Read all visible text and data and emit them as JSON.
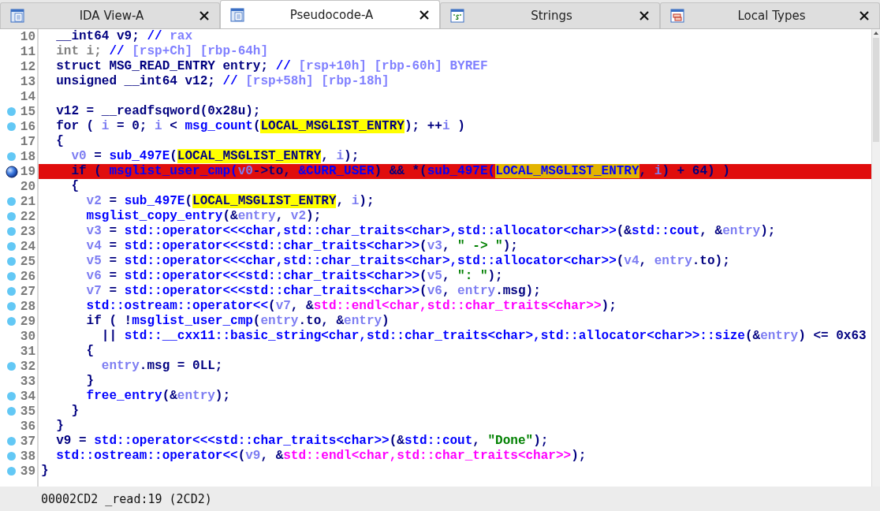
{
  "tabs": [
    {
      "label": "IDA View-A",
      "kind": "view",
      "selected": false
    },
    {
      "label": "Pseudocode-A",
      "kind": "view",
      "selected": true
    },
    {
      "label": "Strings",
      "kind": "strings",
      "selected": false
    },
    {
      "label": "Local Types",
      "kind": "types",
      "selected": false
    }
  ],
  "lines": [
    {
      "number": "10",
      "dot": false,
      "breakpoint": false,
      "tokens": [
        {
          "kind": "kw",
          "text": "  __int64 v9; "
        },
        {
          "kind": "cmt",
          "text": "// "
        },
        {
          "kind": "cmtx",
          "text": "rax"
        }
      ]
    },
    {
      "number": "11",
      "dot": false,
      "breakpoint": false,
      "tokens": [
        {
          "kind": "dim",
          "text": "  int i; "
        },
        {
          "kind": "cmt",
          "text": "// "
        },
        {
          "kind": "cmtx",
          "text": "[rsp+Ch] [rbp-64h]"
        }
      ]
    },
    {
      "number": "12",
      "dot": false,
      "breakpoint": false,
      "tokens": [
        {
          "kind": "kw",
          "text": "  struct MSG_READ_ENTRY entry; "
        },
        {
          "kind": "cmt",
          "text": "// "
        },
        {
          "kind": "cmtx",
          "text": "[rsp+10h] [rbp-60h] BYREF"
        }
      ]
    },
    {
      "number": "13",
      "dot": false,
      "breakpoint": false,
      "tokens": [
        {
          "kind": "kw",
          "text": "  unsigned __int64 v12; "
        },
        {
          "kind": "cmt",
          "text": "// "
        },
        {
          "kind": "cmtx",
          "text": "[rsp+58h] [rbp-18h]"
        }
      ]
    },
    {
      "number": "14",
      "dot": false,
      "breakpoint": false
    },
    {
      "number": "15",
      "dot": true,
      "breakpoint": false,
      "tokens": [
        {
          "kind": "kw",
          "text": "  v12 = __readfsqword(0x28u);"
        }
      ]
    },
    {
      "number": "16",
      "dot": true,
      "breakpoint": false,
      "tokens": [
        {
          "kind": "kw",
          "text": "  for ( "
        },
        {
          "kind": "var",
          "text": "i"
        },
        {
          "kind": "kw",
          "text": " = 0; "
        },
        {
          "kind": "var",
          "text": "i"
        },
        {
          "kind": "kw",
          "text": " < "
        },
        {
          "kind": "fn",
          "text": "msg_count"
        },
        {
          "kind": "kw",
          "text": "("
        },
        {
          "kind": "hl",
          "text": "LOCAL_MSGLIST_ENTRY"
        },
        {
          "kind": "kw",
          "text": "); ++"
        },
        {
          "kind": "var",
          "text": "i"
        },
        {
          "kind": "kw",
          "text": " )"
        }
      ]
    },
    {
      "number": "17",
      "dot": false,
      "breakpoint": false,
      "tokens": [
        {
          "kind": "kw",
          "text": "  {"
        }
      ]
    },
    {
      "number": "18",
      "dot": true,
      "breakpoint": false,
      "tokens": [
        {
          "kind": "var",
          "text": "    v0"
        },
        {
          "kind": "kw",
          "text": " = "
        },
        {
          "kind": "fn",
          "text": "sub_497E"
        },
        {
          "kind": "kw",
          "text": "("
        },
        {
          "kind": "hl",
          "text": "LOCAL_MSGLIST_ENTRY"
        },
        {
          "kind": "kw",
          "text": ", "
        },
        {
          "kind": "var",
          "text": "i"
        },
        {
          "kind": "kw",
          "text": ");"
        }
      ]
    },
    {
      "number": "19",
      "dot": true,
      "breakpoint": true,
      "tokens": [
        {
          "kind": "kw",
          "text": "    if ( "
        },
        {
          "kind": "fn",
          "text": "msglist_user_cmp"
        },
        {
          "kind": "fn",
          "text": "("
        },
        {
          "kind": "var",
          "text": "v0"
        },
        {
          "kind": "kw",
          "text": "->to, "
        },
        {
          "kind": "fn",
          "text": "&CURR_USER"
        },
        {
          "kind": "kw",
          "text": ") && *("
        },
        {
          "kind": "fn",
          "text": "sub_497E"
        },
        {
          "kind": "fn",
          "text": "("
        },
        {
          "kind": "hl",
          "text": "LOCAL_MSGLIST_ENTRY"
        },
        {
          "kind": "kw",
          "text": ", "
        },
        {
          "kind": "var",
          "text": "i"
        },
        {
          "kind": "kw",
          "text": ") + 64) )"
        }
      ]
    },
    {
      "number": "20",
      "dot": false,
      "breakpoint": false,
      "tokens": [
        {
          "kind": "kw",
          "text": "    {"
        }
      ]
    },
    {
      "number": "21",
      "dot": true,
      "breakpoint": false,
      "tokens": [
        {
          "kind": "var",
          "text": "      v2"
        },
        {
          "kind": "kw",
          "text": " = "
        },
        {
          "kind": "fn",
          "text": "sub_497E"
        },
        {
          "kind": "kw",
          "text": "("
        },
        {
          "kind": "hl",
          "text": "LOCAL_MSGLIST_ENTRY"
        },
        {
          "kind": "kw",
          "text": ", "
        },
        {
          "kind": "var",
          "text": "i"
        },
        {
          "kind": "kw",
          "text": ");"
        }
      ]
    },
    {
      "number": "22",
      "dot": true,
      "breakpoint": false,
      "tokens": [
        {
          "kind": "fn",
          "text": "      msglist_copy_entry"
        },
        {
          "kind": "kw",
          "text": "(&"
        },
        {
          "kind": "var",
          "text": "entry"
        },
        {
          "kind": "kw",
          "text": ", "
        },
        {
          "kind": "var",
          "text": "v2"
        },
        {
          "kind": "kw",
          "text": ");"
        }
      ]
    },
    {
      "number": "23",
      "dot": true,
      "breakpoint": false,
      "tokens": [
        {
          "kind": "var",
          "text": "      v3"
        },
        {
          "kind": "kw",
          "text": " = "
        },
        {
          "kind": "fn",
          "text": "std::operator<<<char,std::char_traits<char>,std::allocator<char>>"
        },
        {
          "kind": "kw",
          "text": "(&"
        },
        {
          "kind": "fn",
          "text": "std::cout"
        },
        {
          "kind": "kw",
          "text": ", &"
        },
        {
          "kind": "var",
          "text": "entry"
        },
        {
          "kind": "kw",
          "text": ");"
        }
      ]
    },
    {
      "number": "24",
      "dot": true,
      "breakpoint": false,
      "tokens": [
        {
          "kind": "var",
          "text": "      v4"
        },
        {
          "kind": "kw",
          "text": " = "
        },
        {
          "kind": "fn",
          "text": "std::operator<<<std::char_traits<char>>"
        },
        {
          "kind": "kw",
          "text": "("
        },
        {
          "kind": "var",
          "text": "v3"
        },
        {
          "kind": "kw",
          "text": ", "
        },
        {
          "kind": "str",
          "text": "\" -> \""
        },
        {
          "kind": "kw",
          "text": ");"
        }
      ]
    },
    {
      "number": "25",
      "dot": true,
      "breakpoint": false,
      "tokens": [
        {
          "kind": "var",
          "text": "      v5"
        },
        {
          "kind": "kw",
          "text": " = "
        },
        {
          "kind": "fn",
          "text": "std::operator<<<char,std::char_traits<char>,std::allocator<char>>"
        },
        {
          "kind": "kw",
          "text": "("
        },
        {
          "kind": "var",
          "text": "v4"
        },
        {
          "kind": "kw",
          "text": ", "
        },
        {
          "kind": "var",
          "text": "entry"
        },
        {
          "kind": "kw",
          "text": ".to);"
        }
      ]
    },
    {
      "number": "26",
      "dot": true,
      "breakpoint": false,
      "tokens": [
        {
          "kind": "var",
          "text": "      v6"
        },
        {
          "kind": "kw",
          "text": " = "
        },
        {
          "kind": "fn",
          "text": "std::operator<<<std::char_traits<char>>"
        },
        {
          "kind": "kw",
          "text": "("
        },
        {
          "kind": "var",
          "text": "v5"
        },
        {
          "kind": "kw",
          "text": ", "
        },
        {
          "kind": "str",
          "text": "\": \""
        },
        {
          "kind": "kw",
          "text": ");"
        }
      ]
    },
    {
      "number": "27",
      "dot": true,
      "breakpoint": false,
      "tokens": [
        {
          "kind": "var",
          "text": "      v7"
        },
        {
          "kind": "kw",
          "text": " = "
        },
        {
          "kind": "fn",
          "text": "std::operator<<<std::char_traits<char>>"
        },
        {
          "kind": "kw",
          "text": "("
        },
        {
          "kind": "var",
          "text": "v6"
        },
        {
          "kind": "kw",
          "text": ", "
        },
        {
          "kind": "var",
          "text": "entry"
        },
        {
          "kind": "kw",
          "text": ".msg);"
        }
      ]
    },
    {
      "number": "28",
      "dot": true,
      "breakpoint": false,
      "tokens": [
        {
          "kind": "fn",
          "text": "      std::ostream::operator<<"
        },
        {
          "kind": "kw",
          "text": "("
        },
        {
          "kind": "var",
          "text": "v7"
        },
        {
          "kind": "kw",
          "text": ", &"
        },
        {
          "kind": "mag",
          "text": "std::endl<char,std::char_traits<char>>"
        },
        {
          "kind": "kw",
          "text": ");"
        }
      ]
    },
    {
      "number": "29",
      "dot": true,
      "breakpoint": false,
      "tokens": [
        {
          "kind": "kw",
          "text": "      if ( !"
        },
        {
          "kind": "fn",
          "text": "msglist_user_cmp"
        },
        {
          "kind": "kw",
          "text": "("
        },
        {
          "kind": "var",
          "text": "entry"
        },
        {
          "kind": "kw",
          "text": ".to, &"
        },
        {
          "kind": "var",
          "text": "entry"
        },
        {
          "kind": "kw",
          "text": ")"
        }
      ]
    },
    {
      "number": "30",
      "dot": false,
      "breakpoint": false,
      "tokens": [
        {
          "kind": "kw",
          "text": "        || "
        },
        {
          "kind": "fn",
          "text": "std::__cxx11::basic_string<char,std::char_traits<char>,std::allocator<char>>::size"
        },
        {
          "kind": "kw",
          "text": "(&"
        },
        {
          "kind": "var",
          "text": "entry"
        },
        {
          "kind": "kw",
          "text": ") <= 0x63"
        }
      ]
    },
    {
      "number": "31",
      "dot": false,
      "breakpoint": false,
      "tokens": [
        {
          "kind": "kw",
          "text": "      {"
        }
      ]
    },
    {
      "number": "32",
      "dot": true,
      "breakpoint": false,
      "tokens": [
        {
          "kind": "var",
          "text": "        entry"
        },
        {
          "kind": "kw",
          "text": ".msg = 0LL;"
        }
      ]
    },
    {
      "number": "33",
      "dot": false,
      "breakpoint": false,
      "tokens": [
        {
          "kind": "kw",
          "text": "      }"
        }
      ]
    },
    {
      "number": "34",
      "dot": true,
      "breakpoint": false,
      "tokens": [
        {
          "kind": "fn",
          "text": "      free_entry"
        },
        {
          "kind": "kw",
          "text": "(&"
        },
        {
          "kind": "var",
          "text": "entry"
        },
        {
          "kind": "kw",
          "text": ");"
        }
      ]
    },
    {
      "number": "35",
      "dot": true,
      "breakpoint": false,
      "tokens": [
        {
          "kind": "kw",
          "text": "    }"
        }
      ]
    },
    {
      "number": "36",
      "dot": false,
      "breakpoint": false,
      "tokens": [
        {
          "kind": "kw",
          "text": "  }"
        }
      ]
    },
    {
      "number": "37",
      "dot": true,
      "breakpoint": false,
      "tokens": [
        {
          "kind": "kw",
          "text": "  v9 = "
        },
        {
          "kind": "fn",
          "text": "std::operator<<<std::char_traits<char>>"
        },
        {
          "kind": "kw",
          "text": "(&"
        },
        {
          "kind": "fn",
          "text": "std::cout"
        },
        {
          "kind": "kw",
          "text": ", "
        },
        {
          "kind": "str",
          "text": "\"Done\""
        },
        {
          "kind": "kw",
          "text": ");"
        }
      ]
    },
    {
      "number": "38",
      "dot": true,
      "breakpoint": false,
      "tokens": [
        {
          "kind": "fn",
          "text": "  std::ostream::operator<<"
        },
        {
          "kind": "kw",
          "text": "("
        },
        {
          "kind": "var",
          "text": "v9"
        },
        {
          "kind": "kw",
          "text": ", &"
        },
        {
          "kind": "mag",
          "text": "std::endl<char,std::char_traits<char>>"
        },
        {
          "kind": "kw",
          "text": ");"
        }
      ]
    },
    {
      "number": "39",
      "dot": true,
      "breakpoint": false,
      "tokens": [
        {
          "kind": "kw",
          "text": "}"
        }
      ]
    }
  ],
  "status_bar": "00002CD2 _read:19 (2CD2)"
}
